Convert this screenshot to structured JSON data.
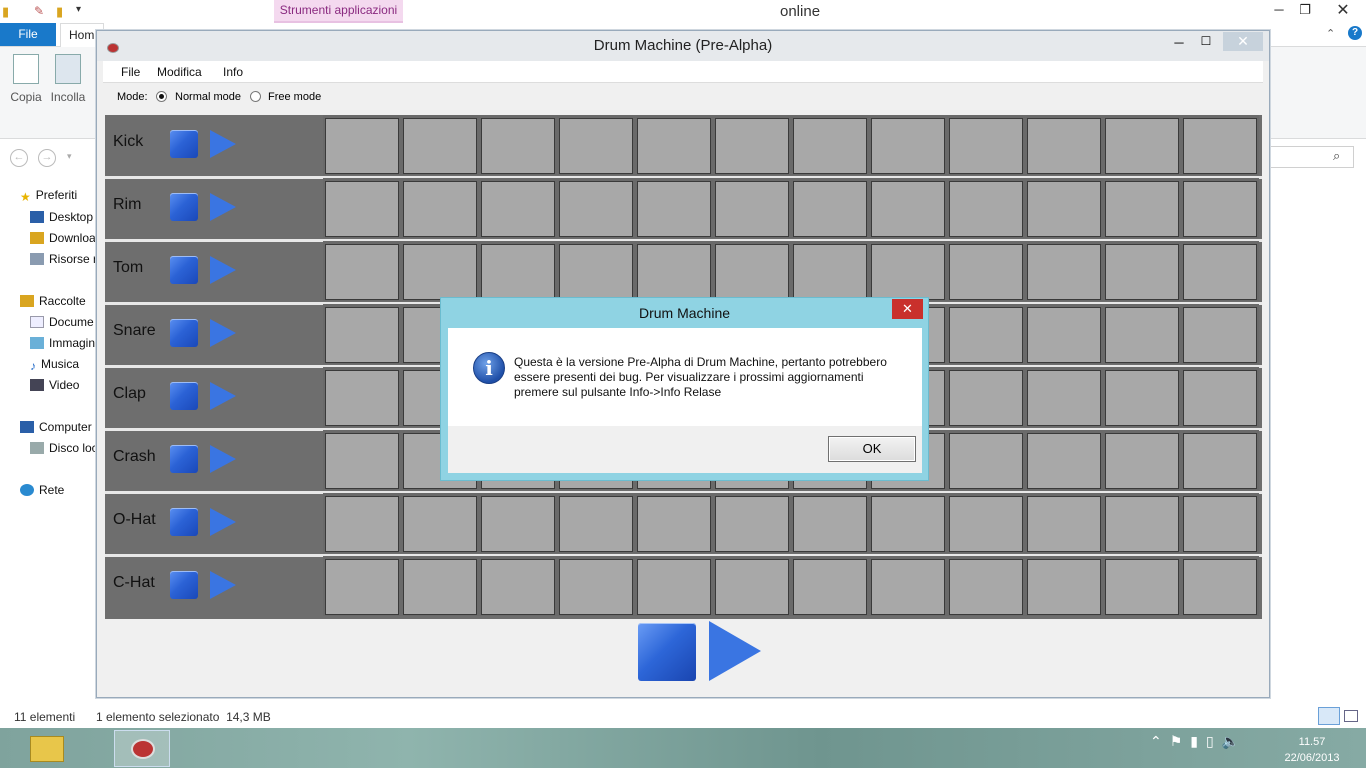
{
  "explorer": {
    "ribbon_tools_tab": "Strumenti applicazioni",
    "window_title": "online",
    "tabs": {
      "file": "File",
      "home": "Hom"
    },
    "ribbon": {
      "copy": "Copia",
      "paste": "Incolla"
    },
    "nav_tree": [
      {
        "label": "Preferiti"
      },
      {
        "label": "Desktop"
      },
      {
        "label": "Downloa"
      },
      {
        "label": "Risorse r"
      },
      {
        "label": "Raccolte"
      },
      {
        "label": "Docume"
      },
      {
        "label": "Immagin"
      },
      {
        "label": "Musica"
      },
      {
        "label": "Video"
      },
      {
        "label": "Computer"
      },
      {
        "label": "Disco loc"
      },
      {
        "label": "Rete"
      }
    ],
    "status": {
      "count": "11 elementi",
      "selection": "1 elemento selezionato  14,3 MB"
    }
  },
  "taskbar": {
    "time": "11.57",
    "date": "22/06/2013"
  },
  "drum_machine": {
    "title": "Drum Machine (Pre-Alpha)",
    "menu": {
      "file": "File",
      "edit": "Modifica",
      "info": "Info"
    },
    "mode": {
      "label": "Mode:",
      "normal": "Normal mode",
      "free": "Free mode",
      "selected": "normal"
    },
    "instruments": [
      "Kick",
      "Rim",
      "Tom",
      "Snare",
      "Clap",
      "Crash",
      "O-Hat",
      "C-Hat"
    ],
    "steps_per_row": 12
  },
  "dialog": {
    "title": "Drum Machine",
    "message": "Questa è la versione Pre-Alpha di Drum Machine, pertanto potrebbero essere presenti dei bug. Per visualizzare i prossimi aggiornamenti premere sul pulsante Info->Info Relase",
    "ok": "OK"
  }
}
